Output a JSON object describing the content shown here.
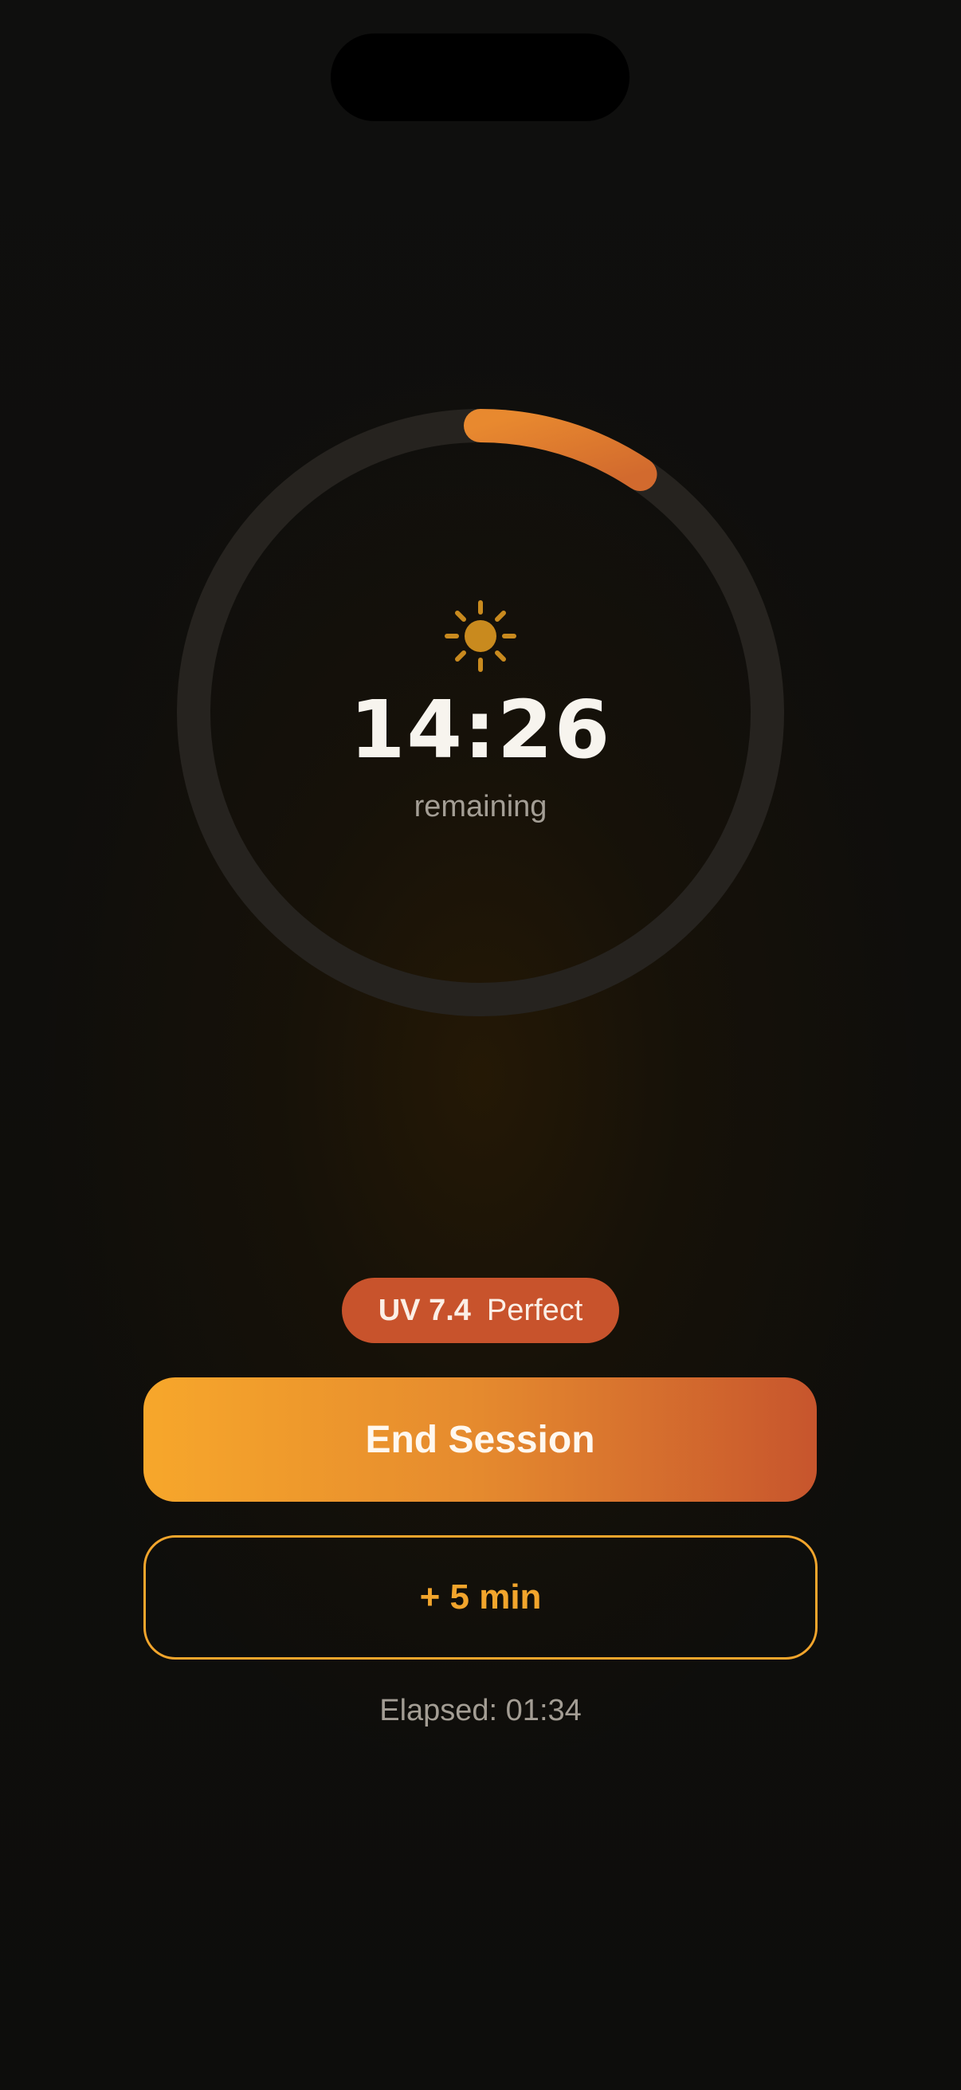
{
  "timer": {
    "time_remaining": "14:26",
    "remaining_label": "remaining",
    "progress_fraction": 0.094
  },
  "uv_badge": {
    "value": "UV 7.4",
    "rating": "Perfect"
  },
  "actions": {
    "end_session_label": "End Session",
    "add_time_label": "+ 5 min"
  },
  "elapsed_text": "Elapsed: 01:34",
  "icons": {
    "center": "sun-icon"
  },
  "colors": {
    "background": "#0e0e0d",
    "ring_track": "#26231f",
    "ring_progress_start": "#e8892f",
    "ring_progress_end": "#d26a2e",
    "uv_badge": "#c8532c",
    "button_gradient_start": "#f7a72b",
    "button_gradient_end": "#c7552d",
    "secondary_accent": "#f2a52c",
    "sun": "#c98a1e"
  }
}
